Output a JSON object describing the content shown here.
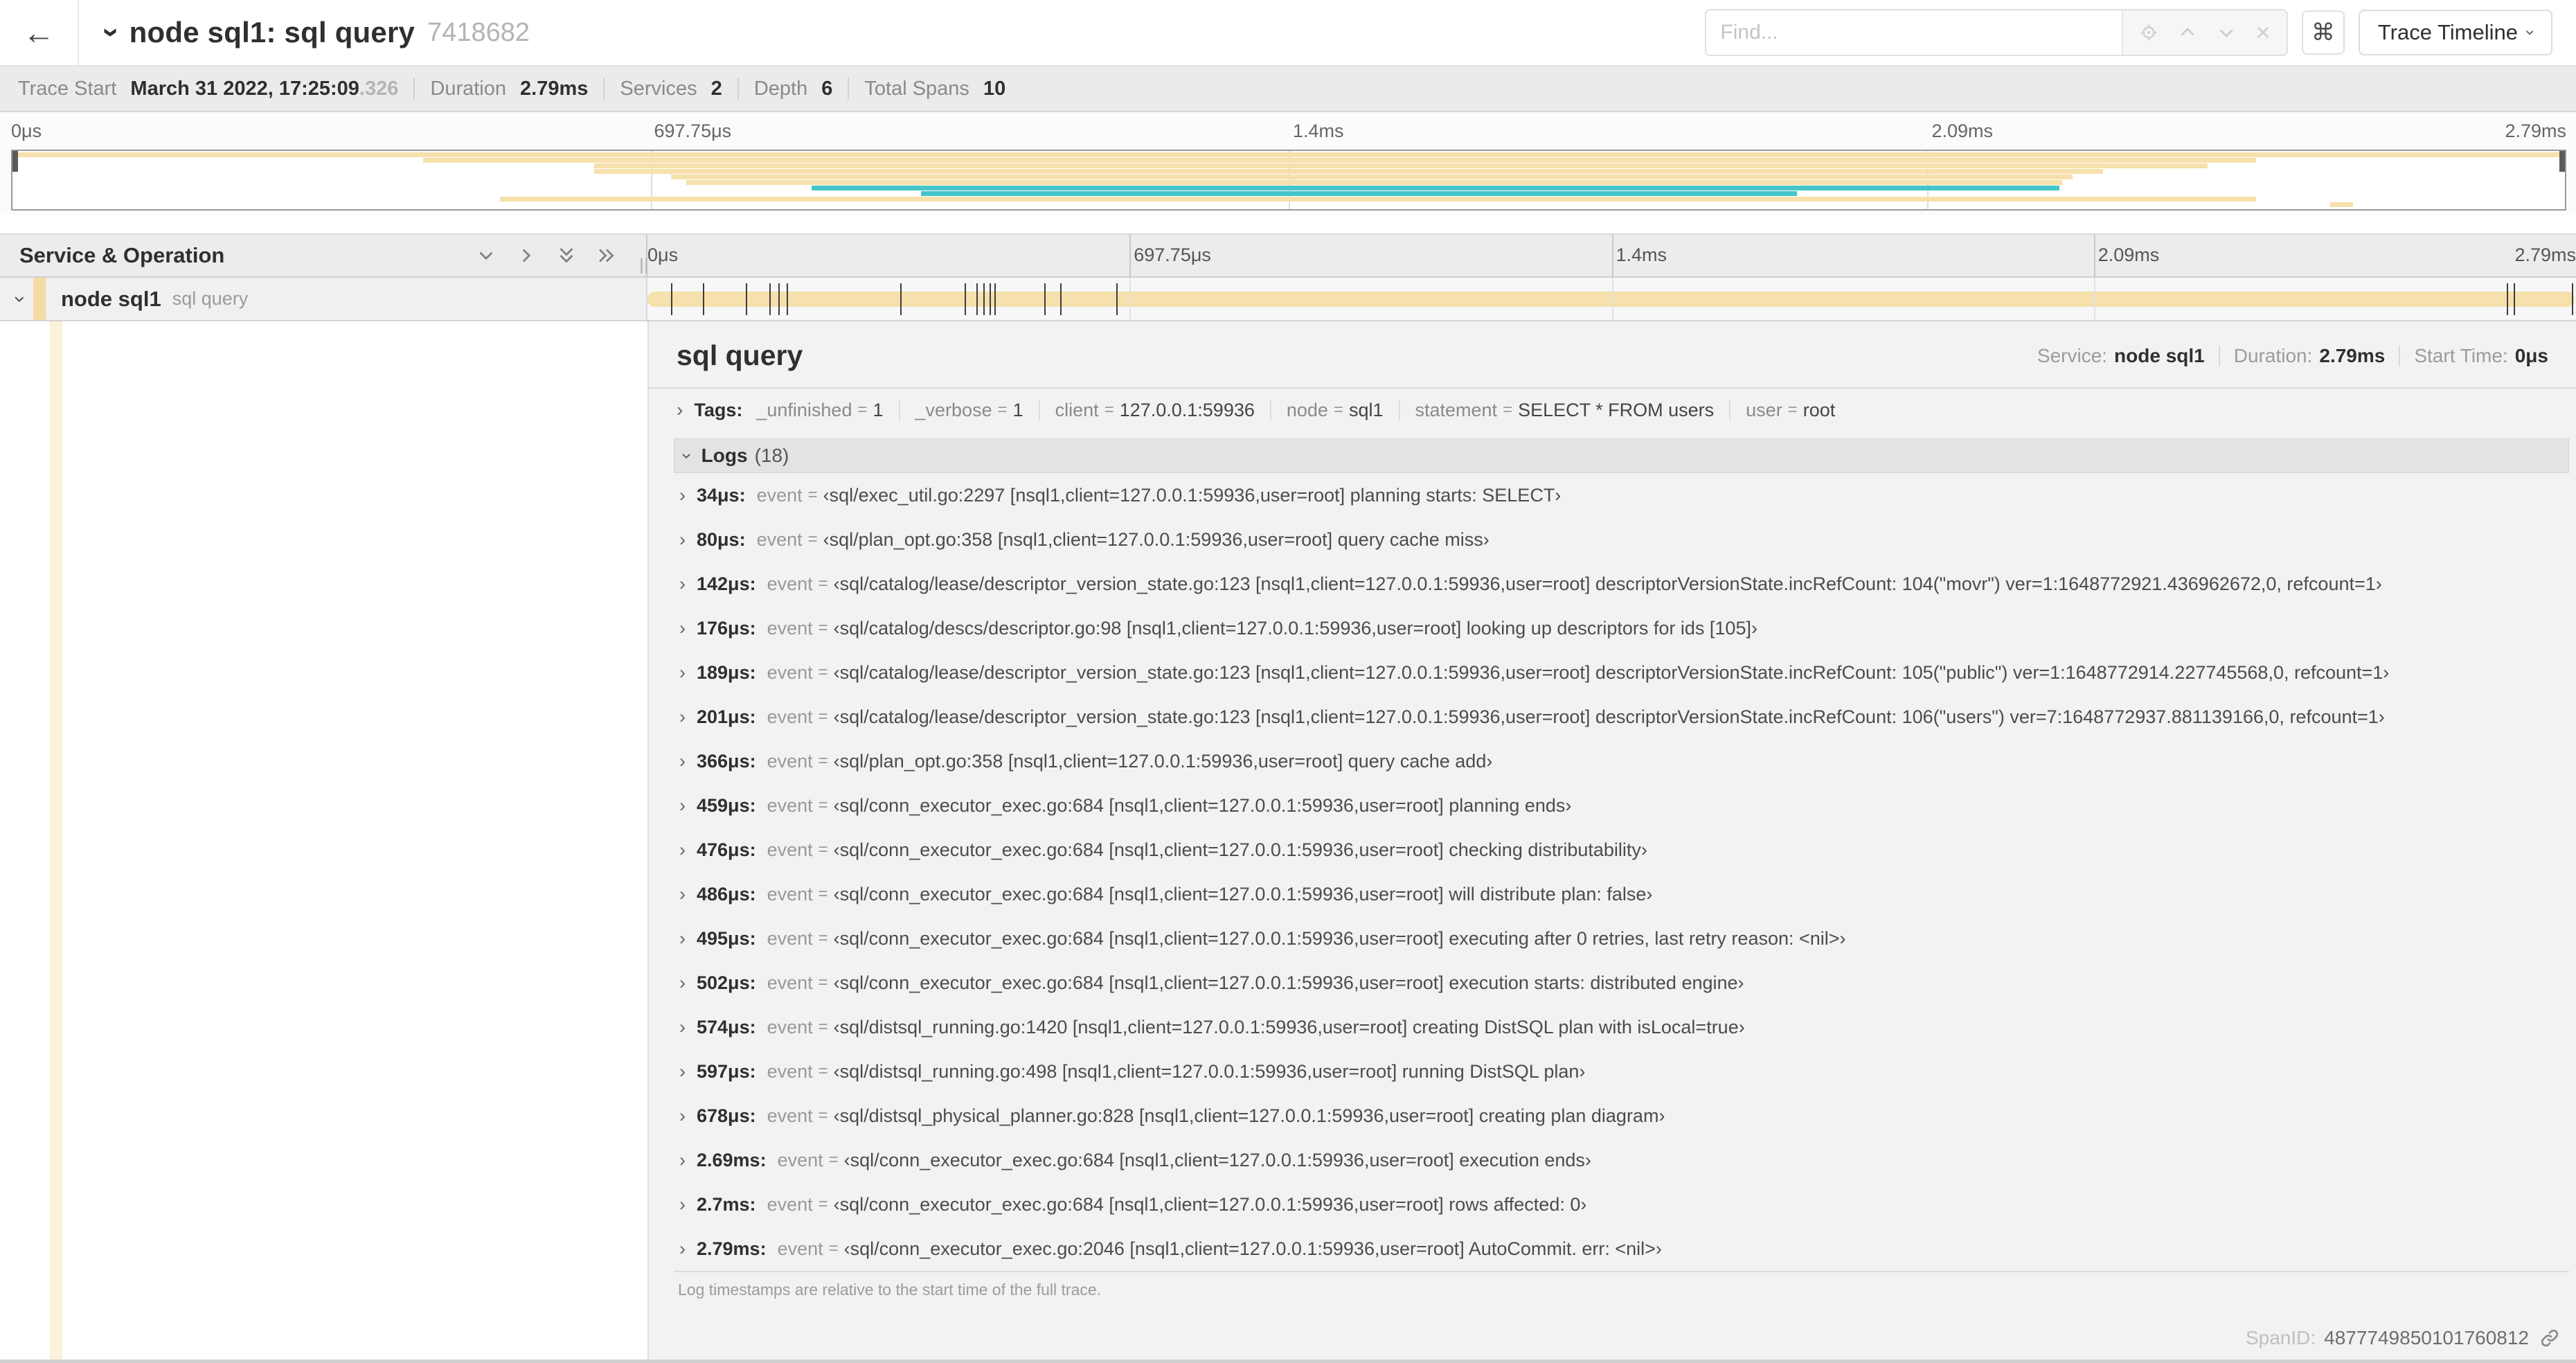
{
  "colors": {
    "tan": "#F6E0AB",
    "tan_strip": "#F5DCA2",
    "tan_pale": "#FBF2DC",
    "teal": "#45C4C9"
  },
  "header": {
    "back_icon": "←",
    "title": "node sql1: sql query",
    "trace_id": "7418682",
    "find_placeholder": "Find...",
    "command_icon": "⌘",
    "view_select": "Trace Timeline"
  },
  "summary": {
    "items": [
      {
        "label": "Trace Start",
        "value": "March 31 2022, 17:25:09",
        "suffix": ".326"
      },
      {
        "label": "Duration",
        "value": "2.79ms"
      },
      {
        "label": "Services",
        "value": "2"
      },
      {
        "label": "Depth",
        "value": "6"
      },
      {
        "label": "Total Spans",
        "value": "10"
      }
    ]
  },
  "ruler": {
    "ticks": [
      {
        "label": "0μs",
        "pos": 0,
        "align": "left"
      },
      {
        "label": "697.75μs",
        "pos": 0.25,
        "align": "left"
      },
      {
        "label": "1.4ms",
        "pos": 0.5,
        "align": "left"
      },
      {
        "label": "2.09ms",
        "pos": 0.75,
        "align": "left"
      },
      {
        "label": "2.79ms",
        "pos": 1,
        "align": "right"
      }
    ]
  },
  "chart_data": {
    "type": "timeline",
    "title": "trace minimap",
    "duration_us": 2790,
    "minimap_spans": [
      {
        "row": 0,
        "start_pct": 0,
        "end_pct": 100,
        "color": "tan"
      },
      {
        "row": 1,
        "start_pct": 16.1,
        "end_pct": 87.9,
        "color": "tan"
      },
      {
        "row": 2,
        "start_pct": 22.8,
        "end_pct": 86.0,
        "color": "tan"
      },
      {
        "row": 3,
        "start_pct": 22.8,
        "end_pct": 81.9,
        "color": "tan"
      },
      {
        "row": 4,
        "start_pct": 25.8,
        "end_pct": 80.7,
        "color": "tan"
      },
      {
        "row": 5,
        "start_pct": 26.4,
        "end_pct": 80.3,
        "color": "tan"
      },
      {
        "row": 6,
        "start_pct": 31.3,
        "end_pct": 80.2,
        "color": "teal"
      },
      {
        "row": 7,
        "start_pct": 35.6,
        "end_pct": 69.9,
        "color": "teal"
      },
      {
        "row": 8,
        "start_pct": 19.1,
        "end_pct": 87.9,
        "color": "tan"
      },
      {
        "row": 9,
        "start_pct": 90.8,
        "end_pct": 91.7,
        "color": "tan"
      }
    ],
    "log_marks_us": [
      34,
      80,
      142,
      176,
      189,
      201,
      366,
      459,
      476,
      486,
      495,
      502,
      574,
      597,
      678,
      2690,
      2700,
      2790
    ]
  },
  "left_panel": {
    "header": "Service & Operation",
    "service": "node sql1",
    "operation": "sql query"
  },
  "detail": {
    "title": "sql query",
    "info": [
      {
        "label": "Service:",
        "value": "node sql1"
      },
      {
        "label": "Duration:",
        "value": "2.79ms"
      },
      {
        "label": "Start Time:",
        "value": "0μs"
      }
    ],
    "tags_label": "Tags:",
    "tags": [
      {
        "key": "_unfinished",
        "value": "1"
      },
      {
        "key": "_verbose",
        "value": "1"
      },
      {
        "key": "client",
        "value": "127.0.0.1:59936"
      },
      {
        "key": "node",
        "value": "sql1"
      },
      {
        "key": "statement",
        "value": "SELECT * FROM users"
      },
      {
        "key": "user",
        "value": "root"
      }
    ],
    "logs_label": "Logs",
    "logs_count": "(18)",
    "event_key": "event",
    "eq": "=",
    "logs": [
      {
        "time": "34μs:",
        "value": "‹sql/exec_util.go:2297 [nsql1,client=127.0.0.1:59936,user=root] planning starts: SELECT›"
      },
      {
        "time": "80μs:",
        "value": "‹sql/plan_opt.go:358 [nsql1,client=127.0.0.1:59936,user=root] query cache miss›"
      },
      {
        "time": "142μs:",
        "value": "‹sql/catalog/lease/descriptor_version_state.go:123 [nsql1,client=127.0.0.1:59936,user=root] descriptorVersionState.incRefCount: 104(\"movr\") ver=1:1648772921.436962672,0, refcount=1›"
      },
      {
        "time": "176μs:",
        "value": "‹sql/catalog/descs/descriptor.go:98 [nsql1,client=127.0.0.1:59936,user=root] looking up descriptors for ids [105]›"
      },
      {
        "time": "189μs:",
        "value": "‹sql/catalog/lease/descriptor_version_state.go:123 [nsql1,client=127.0.0.1:59936,user=root] descriptorVersionState.incRefCount: 105(\"public\") ver=1:1648772914.227745568,0, refcount=1›"
      },
      {
        "time": "201μs:",
        "value": "‹sql/catalog/lease/descriptor_version_state.go:123 [nsql1,client=127.0.0.1:59936,user=root] descriptorVersionState.incRefCount: 106(\"users\") ver=7:1648772937.881139166,0, refcount=1›"
      },
      {
        "time": "366μs:",
        "value": "‹sql/plan_opt.go:358 [nsql1,client=127.0.0.1:59936,user=root] query cache add›"
      },
      {
        "time": "459μs:",
        "value": "‹sql/conn_executor_exec.go:684 [nsql1,client=127.0.0.1:59936,user=root] planning ends›"
      },
      {
        "time": "476μs:",
        "value": "‹sql/conn_executor_exec.go:684 [nsql1,client=127.0.0.1:59936,user=root] checking distributability›"
      },
      {
        "time": "486μs:",
        "value": "‹sql/conn_executor_exec.go:684 [nsql1,client=127.0.0.1:59936,user=root] will distribute plan: false›"
      },
      {
        "time": "495μs:",
        "value": "‹sql/conn_executor_exec.go:684 [nsql1,client=127.0.0.1:59936,user=root] executing after 0 retries, last retry reason: <nil>›"
      },
      {
        "time": "502μs:",
        "value": "‹sql/conn_executor_exec.go:684 [nsql1,client=127.0.0.1:59936,user=root] execution starts: distributed engine›"
      },
      {
        "time": "574μs:",
        "value": "‹sql/distsql_running.go:1420 [nsql1,client=127.0.0.1:59936,user=root] creating DistSQL plan with isLocal=true›"
      },
      {
        "time": "597μs:",
        "value": "‹sql/distsql_running.go:498 [nsql1,client=127.0.0.1:59936,user=root] running DistSQL plan›"
      },
      {
        "time": "678μs:",
        "value": "‹sql/distsql_physical_planner.go:828 [nsql1,client=127.0.0.1:59936,user=root] creating plan diagram›"
      },
      {
        "time": "2.69ms:",
        "value": "‹sql/conn_executor_exec.go:684 [nsql1,client=127.0.0.1:59936,user=root] execution ends›"
      },
      {
        "time": "2.7ms:",
        "value": "‹sql/conn_executor_exec.go:684 [nsql1,client=127.0.0.1:59936,user=root] rows affected: 0›"
      },
      {
        "time": "2.79ms:",
        "value": "‹sql/conn_executor_exec.go:2046 [nsql1,client=127.0.0.1:59936,user=root] AutoCommit. err: <nil>›"
      }
    ],
    "logs_footer": "Log timestamps are relative to the start time of the full trace."
  },
  "footer": {
    "spanid_label": "SpanID:",
    "spanid": "4877749850101760812"
  }
}
